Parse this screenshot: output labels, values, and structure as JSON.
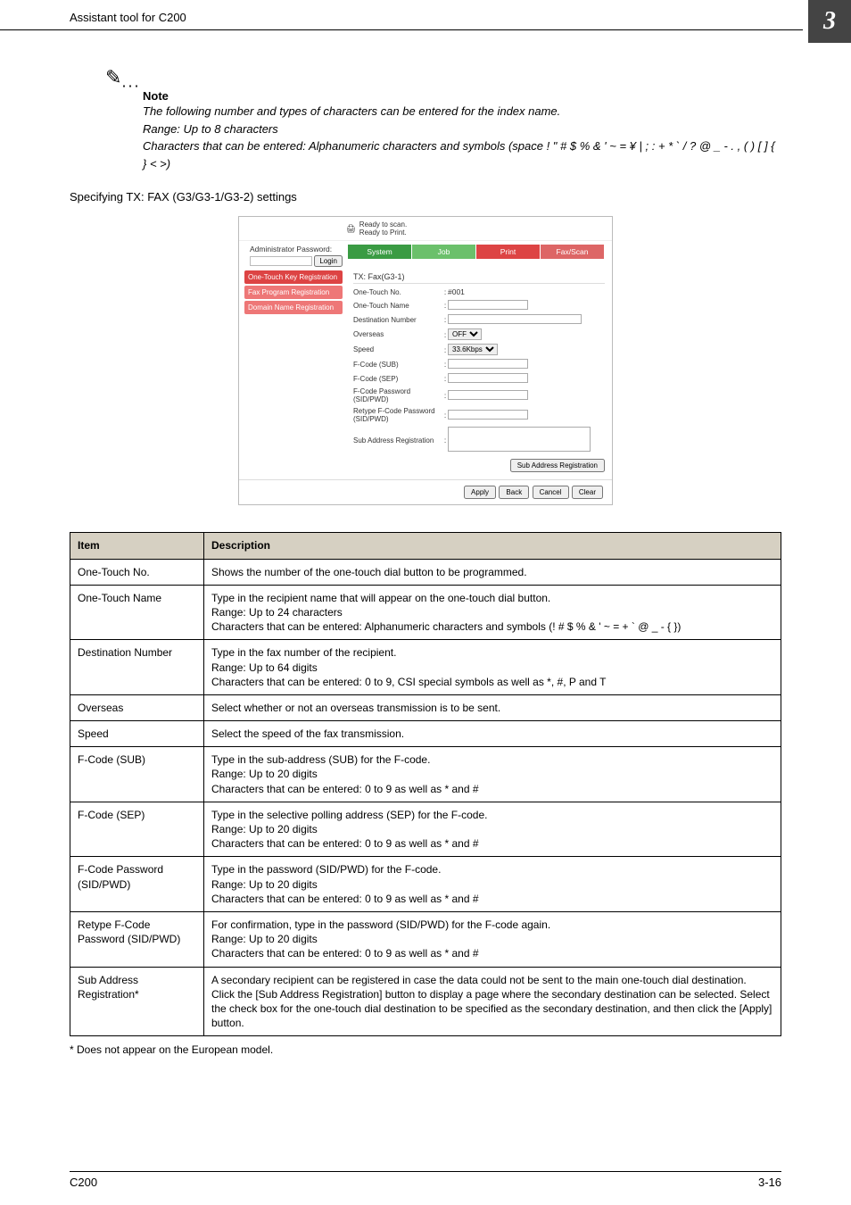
{
  "page": {
    "header_title": "Assistant tool for C200",
    "corner_number": "3",
    "footer_left": "C200",
    "footer_right": "3-16"
  },
  "note": {
    "title": "Note",
    "line1": "The following number and types of characters can be entered for the index name.",
    "line2": "Range: Up to 8 characters",
    "line3": "Characters that can be entered: Alphanumeric characters and symbols (space ! \" # $ % & ' ~ = ¥ | ; : + * ` / ? @ _ - . , ( ) [ ] { } < >)"
  },
  "section_heading": "Specifying TX: FAX (G3/G3-1/G3-2) settings",
  "screenshot": {
    "status1": "Ready to scan.",
    "status2": "Ready to Print.",
    "admin_label": "Administrator Password:",
    "login": "Login",
    "tabs": {
      "system": "System",
      "job": "Job",
      "print": "Print",
      "faxscan": "Fax/Scan"
    },
    "nav": {
      "one_touch": "One-Touch Key Registration",
      "fax_program": "Fax Program Registration",
      "domain_name": "Domain Name Registration"
    },
    "form_title": "TX: Fax(G3-1)",
    "fields": {
      "one_touch_no": "One-Touch No.",
      "one_touch_no_val": "#001",
      "one_touch_name": "One-Touch Name",
      "dest_number": "Destination Number",
      "overseas": "Overseas",
      "overseas_val": "OFF",
      "speed": "Speed",
      "speed_val": "33.6Kbps",
      "fcode_sub": "F-Code (SUB)",
      "fcode_sep": "F-Code (SEP)",
      "fcode_pwd": "F-Code Password (SID/PWD)",
      "retype_fcode_pwd": "Retype F-Code Password (SID/PWD)",
      "sub_addr": "Sub Address Registration"
    },
    "sub_addr_btn": "Sub Address Registration",
    "btns": {
      "apply": "Apply",
      "back": "Back",
      "cancel": "Cancel",
      "clear": "Clear"
    }
  },
  "table": {
    "head_item": "Item",
    "head_desc": "Description",
    "rows": [
      {
        "item": "One-Touch No.",
        "desc": "Shows the number of the one-touch dial button to be programmed."
      },
      {
        "item": "One-Touch Name",
        "desc": "Type in the recipient name that will appear on the one-touch dial button.\nRange: Up to 24 characters\nCharacters that can be entered: Alphanumeric characters and symbols (! # $ % & ' ~ = + ` @ _ - { })"
      },
      {
        "item": "Destination Number",
        "desc": "Type in the fax number of the recipient.\nRange: Up to 64 digits\nCharacters that can be entered: 0 to 9, CSI special symbols as well as *, #, P and T"
      },
      {
        "item": "Overseas",
        "desc": "Select whether or not an overseas transmission is to be sent."
      },
      {
        "item": "Speed",
        "desc": "Select the speed of the fax transmission."
      },
      {
        "item": "F-Code (SUB)",
        "desc": "Type in the sub-address (SUB) for the F-code.\nRange: Up to 20 digits\nCharacters that can be entered: 0 to 9 as well as * and #"
      },
      {
        "item": "F-Code (SEP)",
        "desc": "Type in the selective polling address (SEP) for the F-code.\nRange: Up to 20 digits\nCharacters that can be entered: 0 to 9 as well as * and #"
      },
      {
        "item": "F-Code Password (SID/PWD)",
        "desc": "Type in the password (SID/PWD) for the F-code.\nRange: Up to 20 digits\nCharacters that can be entered: 0 to 9 as well as * and #"
      },
      {
        "item": "Retype F-Code Password (SID/PWD)",
        "desc": "For confirmation, type in the password (SID/PWD) for the F-code again.\nRange: Up to 20 digits\nCharacters that can be entered: 0 to 9 as well as * and #"
      },
      {
        "item": "Sub Address Registration*",
        "desc": "A secondary recipient can be registered in case the data could not be sent to the main one-touch dial destination.\nClick the [Sub Address Registration] button to display a page where the secondary destination can be selected. Select the check box for the one-touch dial destination to be specified as the secondary destination, and then click the [Apply] button."
      }
    ]
  },
  "footnote": "*        Does not appear on the European model."
}
